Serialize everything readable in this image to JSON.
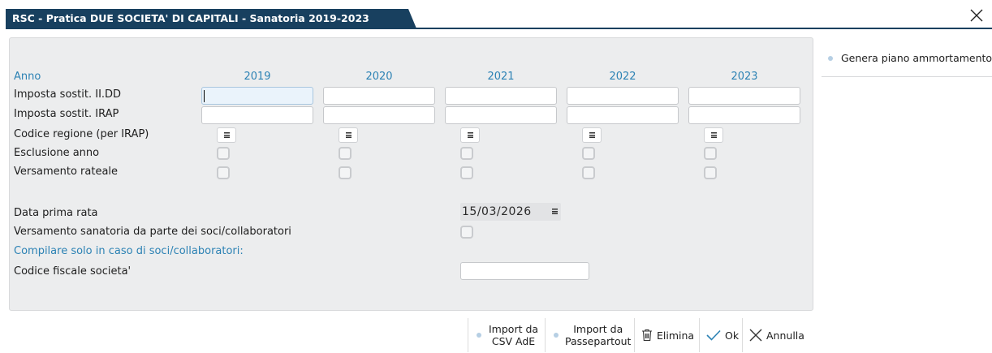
{
  "window": {
    "title": "RSC - Pratica DUE SOCIETA' DI CAPITALI - Sanatoria 2019-2023",
    "accent": "#18405f"
  },
  "form": {
    "anno_label": "Anno",
    "years": [
      "2019",
      "2020",
      "2021",
      "2022",
      "2023"
    ],
    "rows": {
      "imposta_iidd": "Imposta sostit. II.DD",
      "imposta_irap": "Imposta sostit. IRAP",
      "codice_regione": "Codice regione (per IRAP)",
      "esclusione": "Esclusione anno",
      "versamento_rateale": "Versamento rateale"
    },
    "data_prima_rata_label": "Data prima rata",
    "data_prima_rata_value": "15/03/2026",
    "versamento_soci_label": "Versamento sanatoria da parte dei soci/collaboratori",
    "compilare_note": "Compilare solo in caso di soci/collaboratori:",
    "codice_fiscale_label": "Codice fiscale societa'"
  },
  "side": {
    "genera": "Genera piano ammortamento"
  },
  "toolbar": {
    "import_csv": [
      "Import da",
      "CSV AdE"
    ],
    "import_passepartout": [
      "Import da",
      "Passepartout"
    ],
    "elimina": "Elimina",
    "ok": "Ok",
    "annulla": "Annulla"
  },
  "icons": {
    "close": "close-icon",
    "menu": "menu-icon",
    "trash": "trash-icon",
    "check": "check-icon",
    "cancel": "close-icon"
  },
  "colors": {
    "label_blue": "#2c82b4",
    "panel_bg": "#ecedee",
    "dot": "#b6cfe4"
  }
}
